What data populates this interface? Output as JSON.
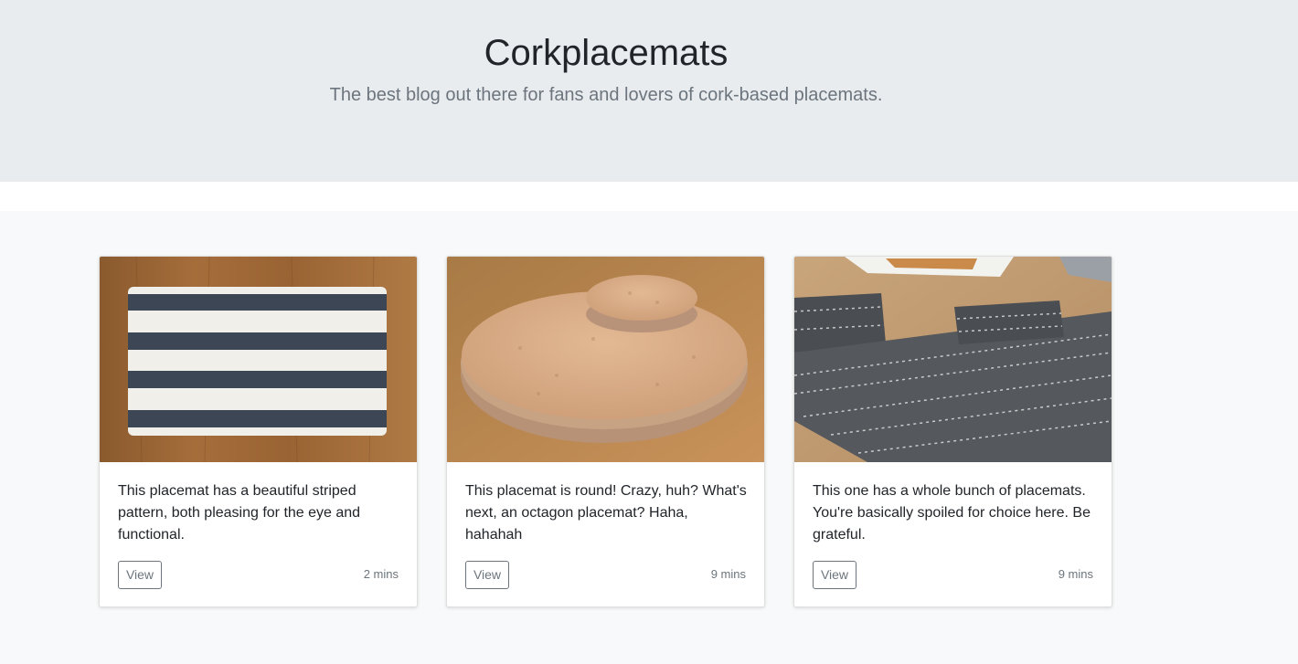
{
  "header": {
    "title": "Corkplacemats",
    "tagline": "The best blog out there for fans and lovers of cork-based placemats."
  },
  "cards": [
    {
      "image_icon": "striped-placemat-photo",
      "text": "This placemat has a beautiful striped pattern, both pleasing for the eye and functional.",
      "button_label": "View",
      "read_time": "2 mins"
    },
    {
      "image_icon": "round-cork-placemat-photo",
      "text": "This placemat is round! Crazy, huh? What's next, an octagon placemat? Haha, hahahah",
      "button_label": "View",
      "read_time": "9 mins"
    },
    {
      "image_icon": "patterned-placemats-set-photo",
      "text": "This one has a whole bunch of placemats. You're basically spoiled for choice here. Be grateful.",
      "button_label": "View",
      "read_time": "9 mins"
    }
  ],
  "colors": {
    "jumbotron_bg": "#e9ecef",
    "album_bg": "#f8f9fa",
    "muted_text": "#6c757d"
  }
}
